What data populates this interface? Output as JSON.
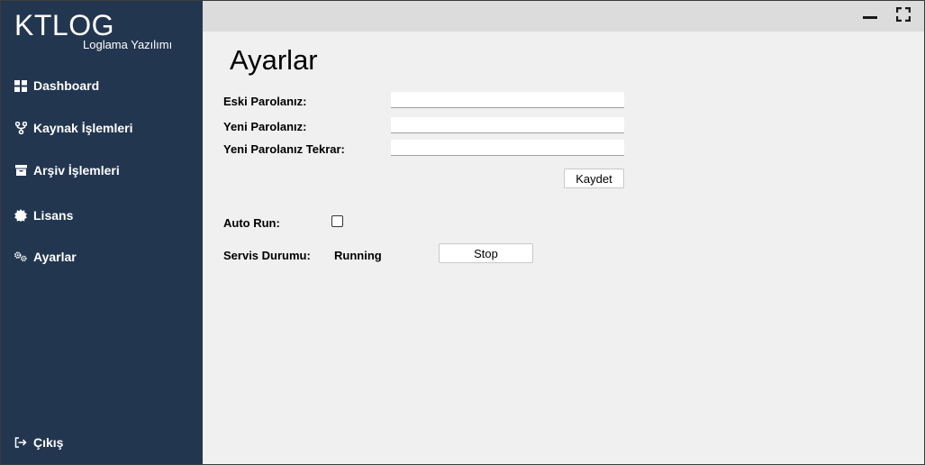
{
  "sidebar": {
    "logo_title": "KTLOG",
    "logo_subtitle": "Loglama Yazılımı",
    "items": [
      {
        "label": "Dashboard",
        "icon": "grid-icon"
      },
      {
        "label": "Kaynak İşlemleri",
        "icon": "branch-icon"
      },
      {
        "label": "Arşiv İşlemleri",
        "icon": "archive-icon"
      },
      {
        "label": "Lisans",
        "icon": "badge-icon"
      },
      {
        "label": "Ayarlar",
        "icon": "cogs-icon"
      }
    ],
    "logout_label": "Çıkış",
    "background": "#22364f"
  },
  "window_controls": {
    "minimize": "minimize-icon",
    "maximize": "fullscreen-icon"
  },
  "page": {
    "title": "Ayarlar"
  },
  "password_form": {
    "old_password_label": "Eski Parolanız:",
    "old_password_value": "",
    "new_password_label": "Yeni Parolanız:",
    "new_password_value": "",
    "confirm_password_label": "Yeni Parolanız Tekrar:",
    "confirm_password_value": "",
    "save_label": "Kaydet"
  },
  "service": {
    "auto_run_label": "Auto Run:",
    "auto_run_checked": false,
    "status_label": "Servis Durumu:",
    "status_value": "Running",
    "stop_label": "Stop"
  }
}
